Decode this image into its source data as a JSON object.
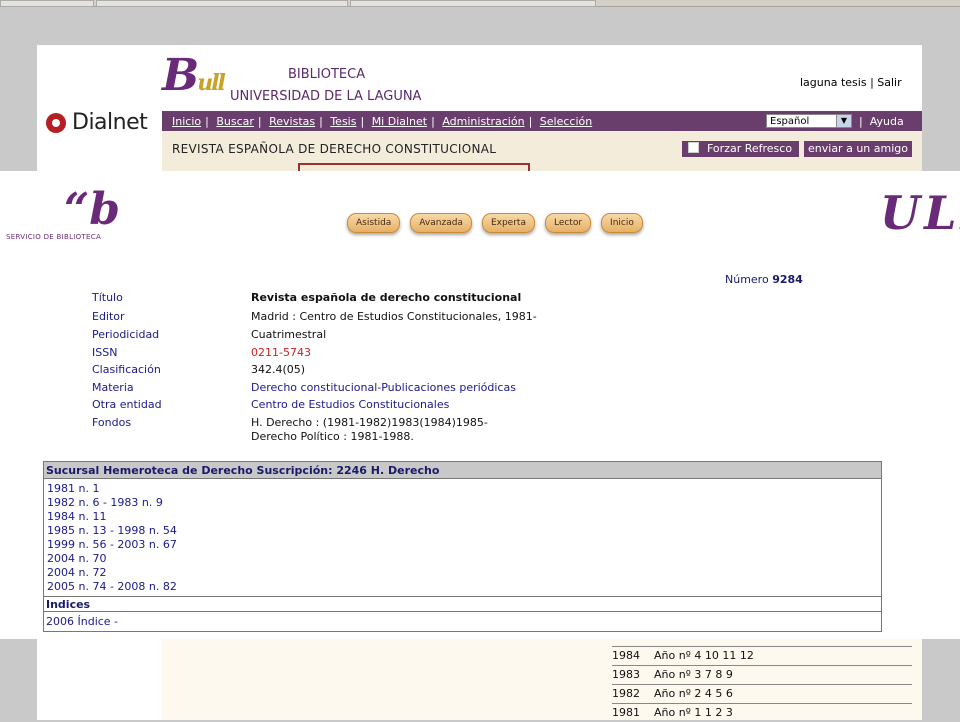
{
  "header": {
    "logo_text": "Dialnet",
    "univ_line1": "BIBLIOTECA",
    "univ_line2": "UNIVERSIDAD DE LA LAGUNA",
    "user_link": "laguna tesis",
    "logout_link": "Salir"
  },
  "nav": {
    "items": [
      "Inicio",
      "Buscar",
      "Revistas",
      "Tesis",
      "Mi Dialnet",
      "Administración",
      "Selección"
    ],
    "language": "Español",
    "help": "Ayuda"
  },
  "journal": {
    "title": "REVISTA ESPAÑOLA DE DERECHO CONSTITUCIONAL",
    "forzar": "Forzar Refresco",
    "enviar": "enviar a un amigo"
  },
  "overlay": {
    "servicio": "SERVICIO DE BIBLIOTECA",
    "ull": "ULL",
    "buttons": [
      "Asistida",
      "Avanzada",
      "Experta",
      "Lector",
      "Inicio"
    ],
    "numero_label": "Número",
    "numero_value": "9284"
  },
  "record": {
    "fields": [
      {
        "label": "Título",
        "value": "Revista española de derecho constitucional",
        "style": "bold"
      },
      {
        "label": "Editor",
        "value": "Madrid : Centro de Estudios Constitucionales, 1981-",
        "style": ""
      },
      {
        "label": "Periodicidad",
        "value": "Cuatrimestral",
        "style": ""
      },
      {
        "label": "ISSN",
        "value": "0211-5743",
        "style": "red"
      },
      {
        "label": "Clasificación",
        "value": "342.4(05)",
        "style": ""
      },
      {
        "label": "Materia",
        "value": "Derecho constitucional-Publicaciones periódicas",
        "style": "link"
      },
      {
        "label": "Otra entidad",
        "value": "Centro de Estudios Constitucionales",
        "style": "link"
      },
      {
        "label": "Fondos",
        "value": "H. Derecho : (1981-1982)1983(1984)1985-",
        "value2": "Derecho Político : 1981-1988.",
        "style": ""
      }
    ]
  },
  "holdings": {
    "header": "Sucursal Hemeroteca de Derecho   Suscripción: 2246 H. Derecho",
    "items": [
      "1981 n. 1",
      "1982 n. 6 - 1983 n. 9",
      "1984 n. 11",
      "1985 n. 13 - 1998 n. 54",
      "1999 n. 56 - 2003 n. 67",
      "2004 n. 70",
      "2004 n. 72",
      "2005 n. 74 - 2008 n. 82"
    ],
    "indices_label": "Indices",
    "indices_items": [
      "2006 Índice -"
    ]
  },
  "years": [
    {
      "year": "1984",
      "numbers": "Año nº 4  10  11  12"
    },
    {
      "year": "1983",
      "numbers": "Año nº 3  7  8  9"
    },
    {
      "year": "1982",
      "numbers": "Año nº 2  4  5  6"
    },
    {
      "year": "1981",
      "numbers": "Año nº 1  1  2  3"
    }
  ]
}
